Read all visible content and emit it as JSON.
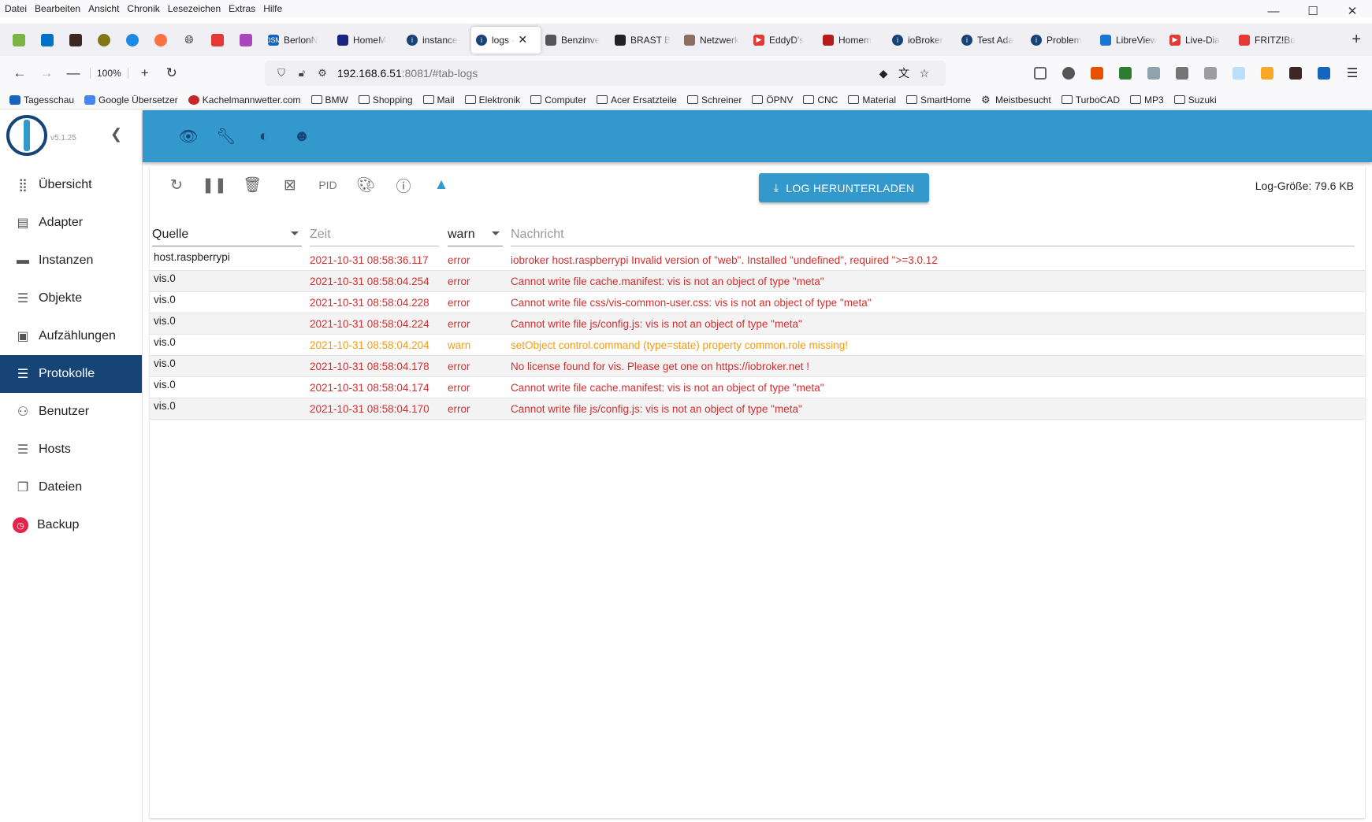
{
  "menubar": [
    "Datei",
    "Bearbeiten",
    "Ansicht",
    "Chronik",
    "Lesezeichen",
    "Extras",
    "Hilfe"
  ],
  "tabs": [
    {
      "label": "BerlonN",
      "color": "#1565c0",
      "glyph": "DSM"
    },
    {
      "label": "HomeM",
      "color": "#1a237e",
      "glyph": ""
    },
    {
      "label": "instance",
      "color": "#164477",
      "glyph": "i"
    },
    {
      "label": "logs -",
      "color": "#164477",
      "glyph": "i",
      "active": true
    },
    {
      "label": "Benzinve",
      "color": "#555555",
      "glyph": ""
    },
    {
      "label": "BRAST B",
      "color": "#222222",
      "glyph": ""
    },
    {
      "label": "Netzwerk",
      "color": "#8d6e63",
      "glyph": ""
    },
    {
      "label": "EddyD's",
      "color": "#e53935",
      "glyph": "▶"
    },
    {
      "label": "Homem",
      "color": "#b71c1c",
      "glyph": ""
    },
    {
      "label": "ioBroker",
      "color": "#164477",
      "glyph": "i"
    },
    {
      "label": "Test Ada",
      "color": "#164477",
      "glyph": "i"
    },
    {
      "label": "Problem",
      "color": "#164477",
      "glyph": "i"
    },
    {
      "label": "LibreView",
      "color": "#1976d2",
      "glyph": ""
    },
    {
      "label": "Live-Dia",
      "color": "#e53935",
      "glyph": "▶"
    },
    {
      "label": "FRITZ!Bo",
      "color": "#e53935",
      "glyph": ""
    }
  ],
  "navigation": {
    "zoom": "100%",
    "url_host": "192.168.6.51",
    "url_rest": ":8081/#tab-logs"
  },
  "bookmarks": [
    {
      "label": "Tagesschau",
      "type": "site",
      "color": "#1565c0"
    },
    {
      "label": "Google Übersetzer",
      "type": "site",
      "color": "#4285f4"
    },
    {
      "label": "Kachelmannwetter.com",
      "type": "site",
      "color": "#c62828"
    },
    {
      "label": "BMW",
      "type": "folder"
    },
    {
      "label": "Shopping",
      "type": "folder"
    },
    {
      "label": "Mail",
      "type": "folder"
    },
    {
      "label": "Elektronik",
      "type": "folder"
    },
    {
      "label": "Computer",
      "type": "folder"
    },
    {
      "label": "Acer Ersatzteile",
      "type": "folder"
    },
    {
      "label": "Schreiner",
      "type": "folder"
    },
    {
      "label": "ÖPNV",
      "type": "folder"
    },
    {
      "label": "CNC",
      "type": "folder"
    },
    {
      "label": "Material",
      "type": "folder"
    },
    {
      "label": "SmartHome",
      "type": "folder"
    },
    {
      "label": "Meistbesucht",
      "type": "gear"
    },
    {
      "label": "TurboCAD",
      "type": "folder"
    },
    {
      "label": "MP3",
      "type": "folder"
    },
    {
      "label": "Suzuki",
      "type": "folder"
    }
  ],
  "app": {
    "version": "v5.1.25",
    "sidebar": [
      {
        "label": "Übersicht",
        "icon": "grid-icon"
      },
      {
        "label": "Adapter",
        "icon": "store-icon"
      },
      {
        "label": "Instanzen",
        "icon": "instances-icon"
      },
      {
        "label": "Objekte",
        "icon": "list-icon"
      },
      {
        "label": "Aufzählungen",
        "icon": "enums-icon"
      },
      {
        "label": "Protokolle",
        "icon": "logs-icon",
        "active": true
      },
      {
        "label": "Benutzer",
        "icon": "user-icon"
      },
      {
        "label": "Hosts",
        "icon": "hosts-icon"
      },
      {
        "label": "Dateien",
        "icon": "files-icon"
      },
      {
        "label": "Backup",
        "icon": "backup-icon"
      }
    ],
    "toolbar": {
      "pid_label": "PID",
      "download_label": "LOG HERUNTERLADEN",
      "log_size": "Log-Größe: 79.6 KB"
    },
    "filters": {
      "source": "Quelle",
      "time_placeholder": "Zeit",
      "severity": "warn",
      "message_placeholder": "Nachricht"
    },
    "logs": [
      {
        "source": "host.raspberrypi",
        "time": "2021-10-31 08:58:36.117",
        "severity": "error",
        "message": "iobroker host.raspberrypi Invalid version of \"web\". Installed \"undefined\", required \">=3.0.12"
      },
      {
        "source": "vis.0",
        "time": "2021-10-31 08:58:04.254",
        "severity": "error",
        "message": "Cannot write file cache.manifest: vis is not an object of type \"meta\""
      },
      {
        "source": "vis.0",
        "time": "2021-10-31 08:58:04.228",
        "severity": "error",
        "message": "Cannot write file css/vis-common-user.css: vis is not an object of type \"meta\""
      },
      {
        "source": "vis.0",
        "time": "2021-10-31 08:58:04.224",
        "severity": "error",
        "message": "Cannot write file js/config.js: vis is not an object of type \"meta\""
      },
      {
        "source": "vis.0",
        "time": "2021-10-31 08:58:04.204",
        "severity": "warn",
        "message": "setObject control.command (type=state) property common.role missing!"
      },
      {
        "source": "vis.0",
        "time": "2021-10-31 08:58:04.178",
        "severity": "error",
        "message": "No license found for vis. Please get one on https://iobroker.net !"
      },
      {
        "source": "vis.0",
        "time": "2021-10-31 08:58:04.174",
        "severity": "error",
        "message": "Cannot write file cache.manifest: vis is not an object of type \"meta\""
      },
      {
        "source": "vis.0",
        "time": "2021-10-31 08:58:04.170",
        "severity": "error",
        "message": "Cannot write file js/config.js: vis is not an object of type \"meta\""
      }
    ]
  },
  "colors": {
    "header_blue": "#3399cc",
    "sidebar_active": "#164477",
    "error": "#d32f2f",
    "warn": "#f39c12"
  }
}
